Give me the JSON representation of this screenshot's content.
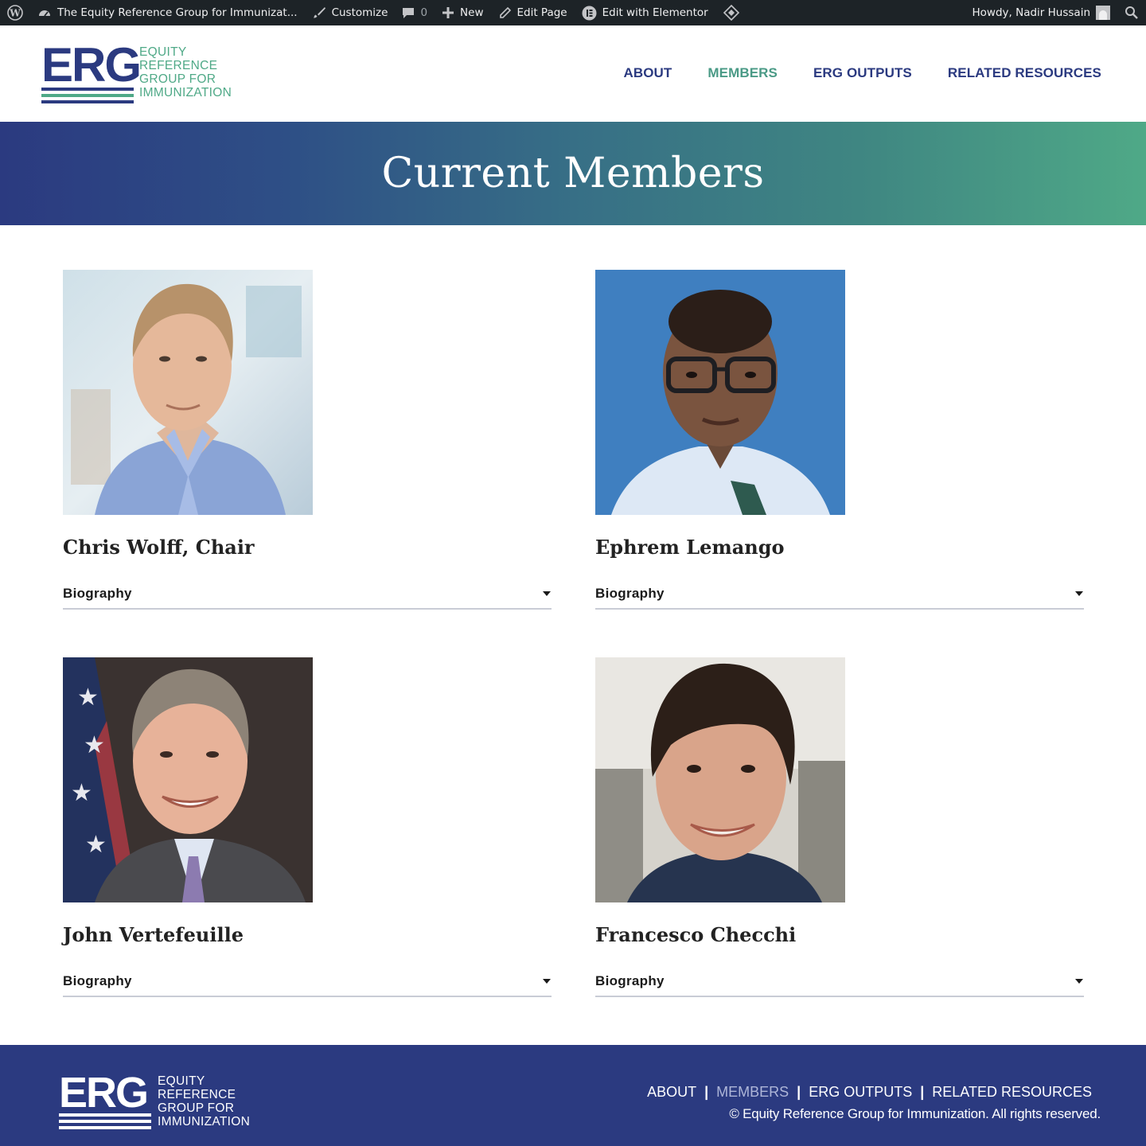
{
  "admin_bar": {
    "site_title": "The Equity Reference Group for Immunizat...",
    "customize": "Customize",
    "comments_count": "0",
    "new": "New",
    "edit_page": "Edit Page",
    "edit_elementor": "Edit with Elementor",
    "howdy": "Howdy, Nadir Hussain"
  },
  "logo": {
    "mark": "ERG",
    "lines": [
      "EQUITY",
      "REFERENCE",
      "GROUP FOR",
      "IMMUNIZATION"
    ]
  },
  "nav": [
    {
      "label": "ABOUT"
    },
    {
      "label": "MEMBERS"
    },
    {
      "label": "ERG OUTPUTS"
    },
    {
      "label": "RELATED RESOURCES"
    }
  ],
  "banner": {
    "title": "Current Members"
  },
  "members": [
    {
      "name": "Chris Wolff, Chair",
      "toggle": "Biography"
    },
    {
      "name": "Ephrem Lemango",
      "toggle": "Biography"
    },
    {
      "name": "John Vertefeuille",
      "toggle": "Biography"
    },
    {
      "name": "Francesco Checchi",
      "toggle": "Biography"
    }
  ],
  "footer": {
    "nav": [
      "ABOUT",
      "MEMBERS",
      "ERG OUTPUTS",
      "RELATED RESOURCES"
    ],
    "copyright": "© Equity Reference Group for Immunization. All rights reserved."
  },
  "colors": {
    "brand_navy": "#2b3a80",
    "brand_green": "#4fa987",
    "admin_bar": "#1d2327"
  }
}
